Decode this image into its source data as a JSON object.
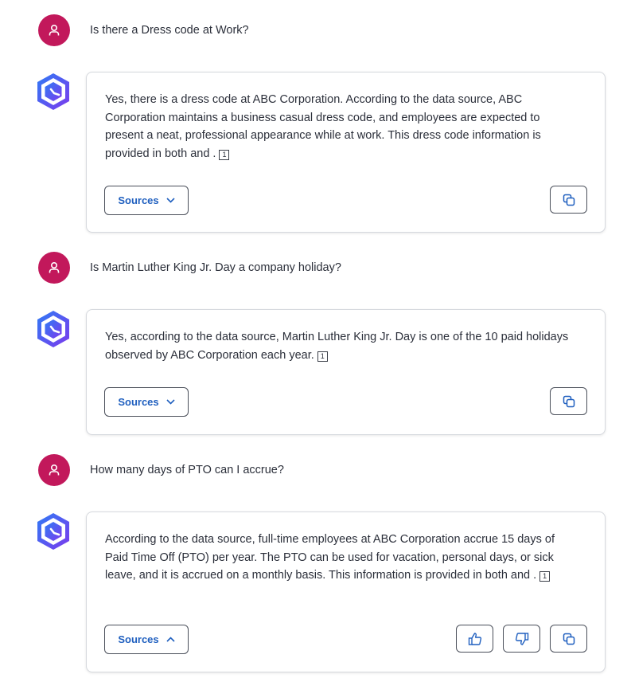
{
  "messages": [
    {
      "question": "Is there a Dress code at Work?",
      "answer": "Yes, there is a dress code at ABC Corporation. According to the data source, ABC Corporation maintains a business casual dress code, and employees are expected to present a neat, professional appearance while at work. This dress code information is provided in both and .",
      "citation": "1",
      "sources_label": "Sources"
    },
    {
      "question": "Is Martin Luther King Jr. Day a company holiday?",
      "answer": "Yes, according to the data source, Martin Luther King Jr. Day is one of the 10 paid holidays observed by ABC Corporation each year.",
      "citation": "1",
      "sources_label": "Sources"
    },
    {
      "question": "How many days of PTO can I accrue?",
      "answer": "According to the data source, full-time employees at ABC Corporation accrue 15 days of Paid Time Off (PTO) per year. The PTO can be used for vacation, personal days, or sick leave, and it is accrued on a monthly basis. This information is provided in both and .",
      "citation": "1",
      "sources_label": "Sources"
    }
  ],
  "colors": {
    "user_avatar": "#c2185b",
    "link_blue": "#1f5fbf",
    "bot_gradient": [
      "#2f7bf5",
      "#7c3aed"
    ]
  }
}
